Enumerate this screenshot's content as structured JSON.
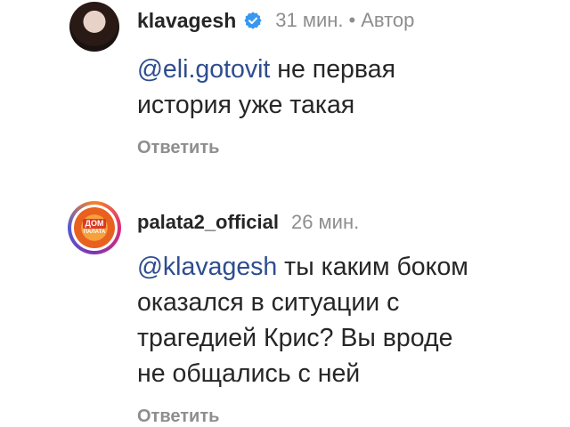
{
  "comments": [
    {
      "username": "klavagesh",
      "verified": true,
      "time": "31 мин.",
      "author_badge": "Автор",
      "mention": "@eli.gotovit",
      "text_line1": " не первая",
      "text_line2": "история уже такая",
      "reply_label": "Ответить"
    },
    {
      "username": "palata2_official",
      "verified": false,
      "time": "26 мин.",
      "avatar_text_top": "ДОМ",
      "avatar_text_bottom": "ПАЛАТА",
      "mention": "@klavagesh",
      "text_line1": " ты каким боком",
      "text_line2": "оказался в ситуации с",
      "text_line3": "трагедией Крис? Вы вроде",
      "text_line4": "не общались с ней",
      "reply_label": "Ответить"
    }
  ],
  "colors": {
    "mention": "#2e4d8f",
    "secondary_text": "#8e8e8e",
    "verified_badge": "#3897f0"
  },
  "icons": {
    "verified": "verified-badge-icon",
    "separator": "•"
  }
}
